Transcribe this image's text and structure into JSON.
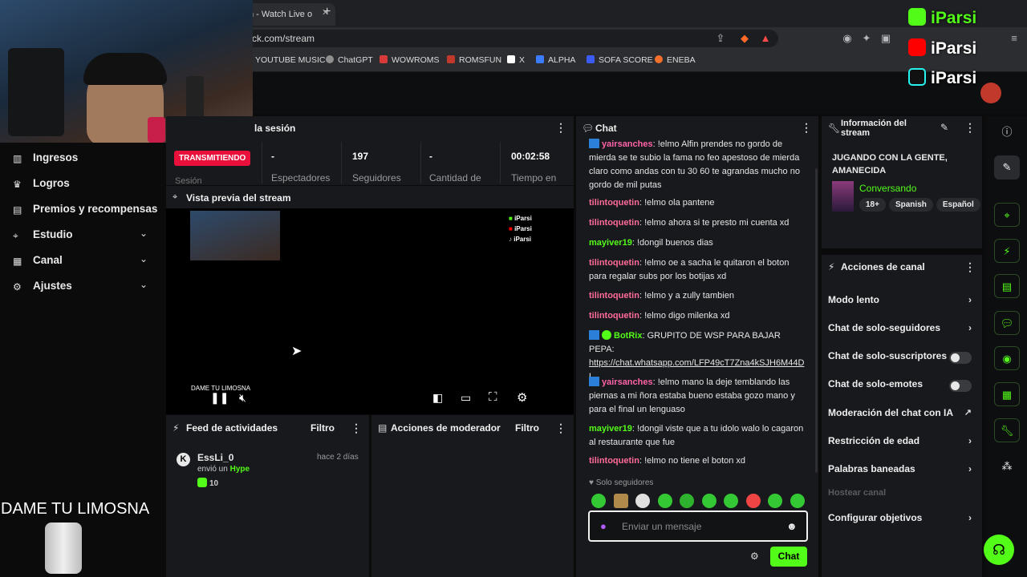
{
  "browser": {
    "tab_title": "n - Watch Live o",
    "url": "ck.com/stream",
    "bookmarks": [
      "YOUTUBE MUSIC",
      "ChatGPT",
      "WOWROMS",
      "ROMSFUN",
      "X",
      "ALPHA",
      "SOFA SCORE",
      "ENEBA"
    ]
  },
  "overlay": {
    "social": [
      "iParsi",
      "iParsi",
      "iParsi"
    ],
    "donation_text": "DAME TU LIMOSNA"
  },
  "sidebar": {
    "items": [
      {
        "label": "Ingresos",
        "icon": "chart-icon"
      },
      {
        "label": "Logros",
        "icon": "trophy-icon"
      },
      {
        "label": "Premios y recompensas",
        "icon": "gift-icon"
      },
      {
        "label": "Estudio",
        "icon": "camera-icon",
        "expandable": true
      },
      {
        "label": "Canal",
        "icon": "layout-icon",
        "expandable": true
      },
      {
        "label": "Ajustes",
        "icon": "gear-icon",
        "expandable": true
      }
    ]
  },
  "session": {
    "title": "la sesión",
    "status_badge": "TRANSMITIENDO",
    "status_label": "Sesión",
    "stats": [
      {
        "value": "-",
        "label": "Espectadores"
      },
      {
        "value": "197",
        "label": "Seguidores"
      },
      {
        "value": "-",
        "label": "Cantidad de"
      },
      {
        "value": "00:02:58",
        "label": "Tiempo en"
      }
    ]
  },
  "preview": {
    "title": "Vista previa del stream",
    "mini_social": [
      "iParsi",
      "iParsi",
      "iParsi"
    ],
    "donation_text": "DAME TU LIMOSNA"
  },
  "feed": {
    "title": "Feed de actividades",
    "filter": "Filtro",
    "item": {
      "user": "EssLi_0",
      "time": "hace 2 días",
      "action": "envió un",
      "kind": "Hype",
      "amount": "10"
    }
  },
  "mod": {
    "title": "Acciones de moderador",
    "filter": "Filtro"
  },
  "chat": {
    "title": "Chat",
    "messages": [
      {
        "user": "yairsanches",
        "color": "#ff63a8",
        "text": "!elmo Alfin prendes no gordo de mierda se te subio la fama no feo apestoso de mierda claro como andas con tu 30 60 te agrandas mucho no gordo de mil putas"
      },
      {
        "user": "tilintoquetin",
        "color": "#ff6b9a",
        "text": "!elmo ola pantene"
      },
      {
        "user": "tilintoquetin",
        "color": "#ff6b9a",
        "text": "!elmo ahora si te presto mi cuenta xd"
      },
      {
        "user": "mayiver19",
        "color": "#53fc18",
        "text": "!dongil buenos dias"
      },
      {
        "user": "tilintoquetin",
        "color": "#ff6b9a",
        "text": "!elmo oe a sacha le quitaron el boton para regalar subs por los botijas xd"
      },
      {
        "user": "tilintoquetin",
        "color": "#ff6b9a",
        "text": "!elmo y a zully tambien"
      },
      {
        "user": "tilintoquetin",
        "color": "#ff6b9a",
        "text": "!elmo digo milenka xd"
      },
      {
        "user": "BotRix",
        "color": "#53fc18",
        "text": "GRUPITO DE WSP PARA BAJAR PEPA:",
        "link": "https://chat.whatsapp.com/LFP49cT7Zna4kSJH6M44DL"
      },
      {
        "user": "yairsanches",
        "color": "#ff63a8",
        "text": "!elmo mano la deje temblando las piernas a mi ñora estaba bueno estaba gozo mano y para el final un lenguaso"
      },
      {
        "user": "mayiver19",
        "color": "#53fc18",
        "text": "!dongil viste que a tu idolo walo lo cagaron al restaurante que fue"
      },
      {
        "user": "tilintoquetin",
        "color": "#ff6b9a",
        "text": "!elmo no tiene el boton xd"
      }
    ],
    "followers_only": "Solo seguidores",
    "input_placeholder": "Enviar un mensaje",
    "send_label": "Chat"
  },
  "info": {
    "title": "Información del stream",
    "stream_title": "JUGANDO CON LA GENTE, AMANECIDA",
    "category": "Conversando",
    "tags": [
      "18+",
      "Spanish",
      "Español"
    ]
  },
  "actions": {
    "title": "Acciones de canal",
    "items": [
      {
        "label": "Modo lento",
        "type": "chevron"
      },
      {
        "label": "Chat de solo-seguidores",
        "type": "chevron"
      },
      {
        "label": "Chat de solo-suscriptores",
        "type": "toggle"
      },
      {
        "label": "Chat de solo-emotes",
        "type": "toggle"
      },
      {
        "label": "Moderación del chat con IA",
        "type": "external"
      },
      {
        "label": "Restricción de edad",
        "type": "chevron"
      },
      {
        "label": "Palabras baneadas",
        "type": "chevron"
      },
      {
        "label": "Hostear canal",
        "type": "disabled"
      },
      {
        "label": "Configurar objetivos",
        "type": "chevron"
      }
    ]
  },
  "colors": {
    "accent": "#53fc18",
    "live": "#e9113c",
    "panel": "#18191c"
  }
}
